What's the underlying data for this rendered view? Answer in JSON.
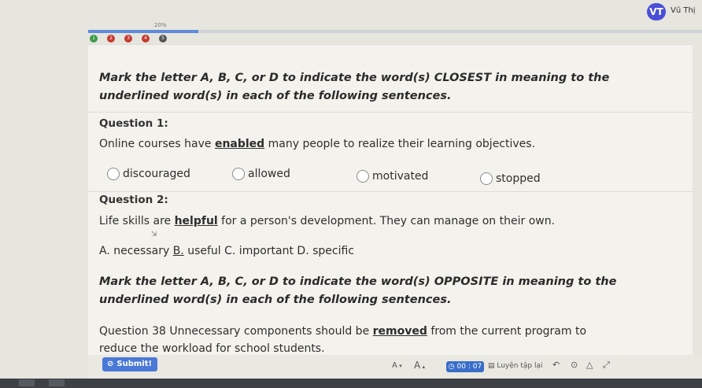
{
  "header": {
    "avatar_initials": "VT",
    "user_name": "Vũ Thị",
    "progress_label": "20%",
    "progress_percent": 18,
    "step_labels": [
      "1",
      "2",
      "3",
      "4",
      "5"
    ],
    "colors": {
      "accent": "#4a4fd8",
      "progress": "#5b8bd9"
    }
  },
  "section1": {
    "instruction_line1": "Mark the letter A, B, C, or D to indicate the word(s) CLOSEST in meaning to the",
    "instruction_line2": "underlined word(s) in each of the following sentences."
  },
  "question1": {
    "title": "Question 1:",
    "text_before": "Online courses have ",
    "text_underlined": "enabled",
    "text_after": " many people to realize their learning objectives.",
    "options": [
      "discouraged",
      "allowed",
      "motivated",
      "stopped"
    ]
  },
  "question2": {
    "title": "Question 2:",
    "text_before": "Life skills are ",
    "text_underlined": "helpful",
    "text_after": " for a person's development. They can manage on their own.",
    "answers_a": "A. necessary ",
    "answers_b": "B.",
    "answers_rest": " useful C. important D. specific"
  },
  "section2": {
    "instruction_line1": "Mark the letter A, B, C, or D to indicate the word(s) OPPOSITE in meaning to the",
    "instruction_line2": "underlined word(s) in each of the following sentences."
  },
  "question38": {
    "text_before": "Question 38 Unnecessary components should be ",
    "text_underlined": "removed",
    "text_after": " from the current program to",
    "line2": "reduce the workload for school students."
  },
  "footer": {
    "submit_label": "Submit!",
    "font_decrease": "A",
    "font_increase": "A",
    "timer": "00 : 07",
    "practice_label": "Luyện tập lại",
    "icons": [
      "undo-icon",
      "help-icon",
      "warning-icon",
      "expand-icon"
    ]
  }
}
